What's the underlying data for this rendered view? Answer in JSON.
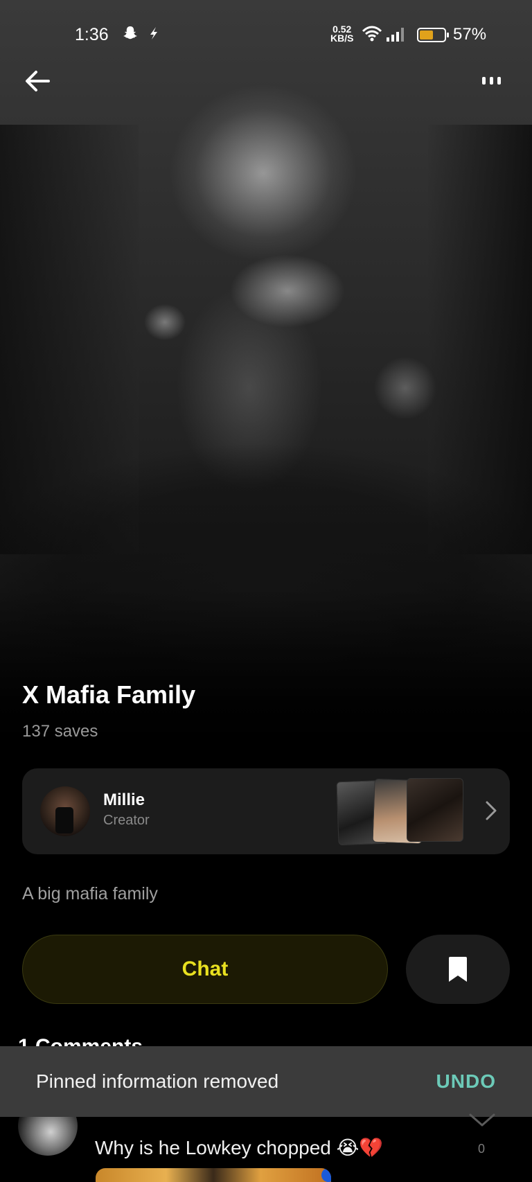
{
  "status_bar": {
    "time": "1:36",
    "left_icons": [
      "snapchat-icon",
      "bolt-icon"
    ],
    "network_speed_value": "0.52",
    "network_speed_unit": "KB/S",
    "battery_percent": "57%",
    "battery_level": 0.57,
    "battery_color": "#e0a21b"
  },
  "header": {
    "back_icon": "arrow-left-icon",
    "more_icon": "more-dots-icon"
  },
  "board": {
    "title": "X Mafia Family",
    "saves": "137 saves",
    "description": "A big mafia family"
  },
  "creator": {
    "name": "Millie",
    "role": "Creator"
  },
  "actions": {
    "chat_label": "Chat",
    "chat_color": "#e8e020",
    "bookmark_icon": "bookmark-icon"
  },
  "comments": {
    "heading": "1 Comments",
    "items": [
      {
        "text": "Why is he Lowkey chopped 😭💔",
        "likes": "0"
      }
    ]
  },
  "snackbar": {
    "message": "Pinned information removed",
    "action": "UNDO",
    "action_color": "#6ccab8"
  }
}
